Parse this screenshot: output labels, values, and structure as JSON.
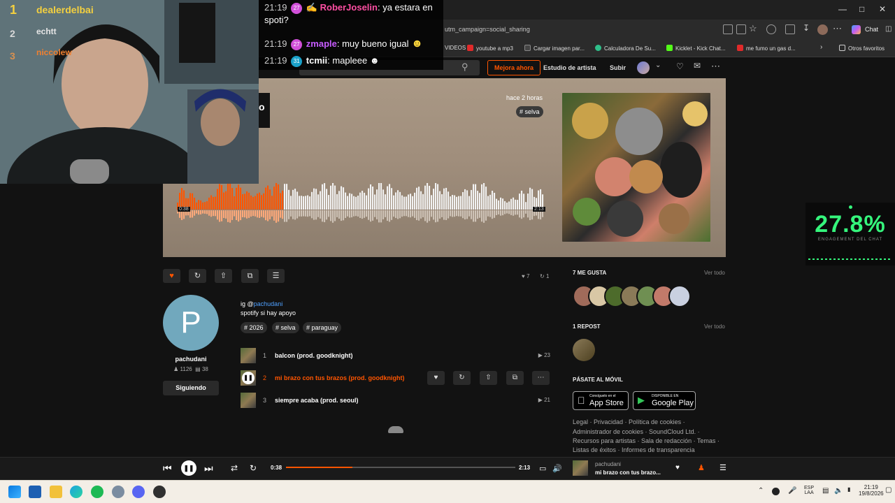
{
  "browser": {
    "url": "utm_campaign=social_sharing",
    "chat_button": "Chat",
    "bookmarks": [
      "VIDEOS",
      "youtube a mp3",
      "Cargar imagen par...",
      "Calculadora De Su...",
      "Kicklet - Kick Chat...",
      "me fumo un gas d..."
    ],
    "other_favorites": "Otros favoritos"
  },
  "header": {
    "upgrade": "Mejora ahora",
    "studio": "Estudio de artista",
    "upload": "Subir"
  },
  "hero": {
    "posted": "hace 2 horas",
    "tag": "# selva",
    "time_current": "0:38",
    "time_total": "2:13",
    "progress": 0.29
  },
  "actions": {
    "likes": "7",
    "reposts": "1"
  },
  "artist": {
    "initial": "P",
    "name": "pachudani",
    "followers": "1126",
    "following": "38",
    "follow_label": "Siguiendo"
  },
  "description": {
    "line1_prefix": "ig @",
    "line1_link": "pachudani",
    "line2": "spotify si hay apoyo",
    "tags": [
      "# 2026",
      "# selva",
      "# paraguay"
    ]
  },
  "tracks": [
    {
      "num": "1",
      "title": "balcon (prod. goodknight)",
      "plays": "23",
      "active": false
    },
    {
      "num": "2",
      "title": "mi brazo con tus brazos (prod. goodknight)",
      "plays": "",
      "active": true
    },
    {
      "num": "3",
      "title": "siempre acaba (prod. seoul)",
      "plays": "21",
      "active": false
    }
  ],
  "sidebar": {
    "likes_heading": "7 ME GUSTA",
    "reposts_heading": "1 REPOST",
    "view_all": "Ver todo",
    "mobile_heading": "PÁSATE AL MÓVIL",
    "appstore_small": "Consíguelo en el",
    "appstore": "App Store",
    "googleplay_small": "DISPONIBLE EN",
    "googleplay": "Google Play",
    "footer_lines": [
      "Legal · Privacidad · Política de cookies ·",
      "Administrador de cookies · SoundCloud Ltd. ·",
      "Recursos para artistas · Sala de redacción · Temas ·",
      "Listas de éxitos · Informes de transparencia"
    ]
  },
  "player": {
    "time_current": "0:38",
    "time_total": "2:13",
    "progress": 0.29,
    "artist": "pachudani",
    "title": "mi brazo con tus brazo..."
  },
  "taskbar": {
    "lang1": "ESP",
    "lang2": "LAA",
    "time": "21:19",
    "date": "19/8/2026"
  },
  "chat": [
    {
      "time": "21:19",
      "badge": "27",
      "badge_color": "#d04fd8",
      "user": "RoberJoselin",
      "user_color": "#ff4fa3",
      "message": ": ya estara en",
      "cont": "spoti?"
    },
    {
      "time": "21:19",
      "badge": "27",
      "badge_color": "#d04fd8",
      "user": "zmaple",
      "user_color": "#c75cff",
      "message": ": muy bueno igual",
      "cont": ""
    },
    {
      "time": "21:19",
      "badge": "31",
      "badge_color": "#1aa0c8",
      "user": "tcmii",
      "user_color": "#ffffff",
      "message": ": mapleee",
      "cont": ""
    }
  ],
  "leaderboard": [
    {
      "rank": "1",
      "name": "dealerdelbai"
    },
    {
      "rank": "2",
      "name": "echtt"
    },
    {
      "rank": "3",
      "name": "niccolew"
    }
  ],
  "engagement": {
    "value": "27.8%",
    "label": "ENGAGEMENT DEL CHAT"
  },
  "colors": {
    "accent": "#ff5500",
    "engagement": "#35f57c"
  }
}
